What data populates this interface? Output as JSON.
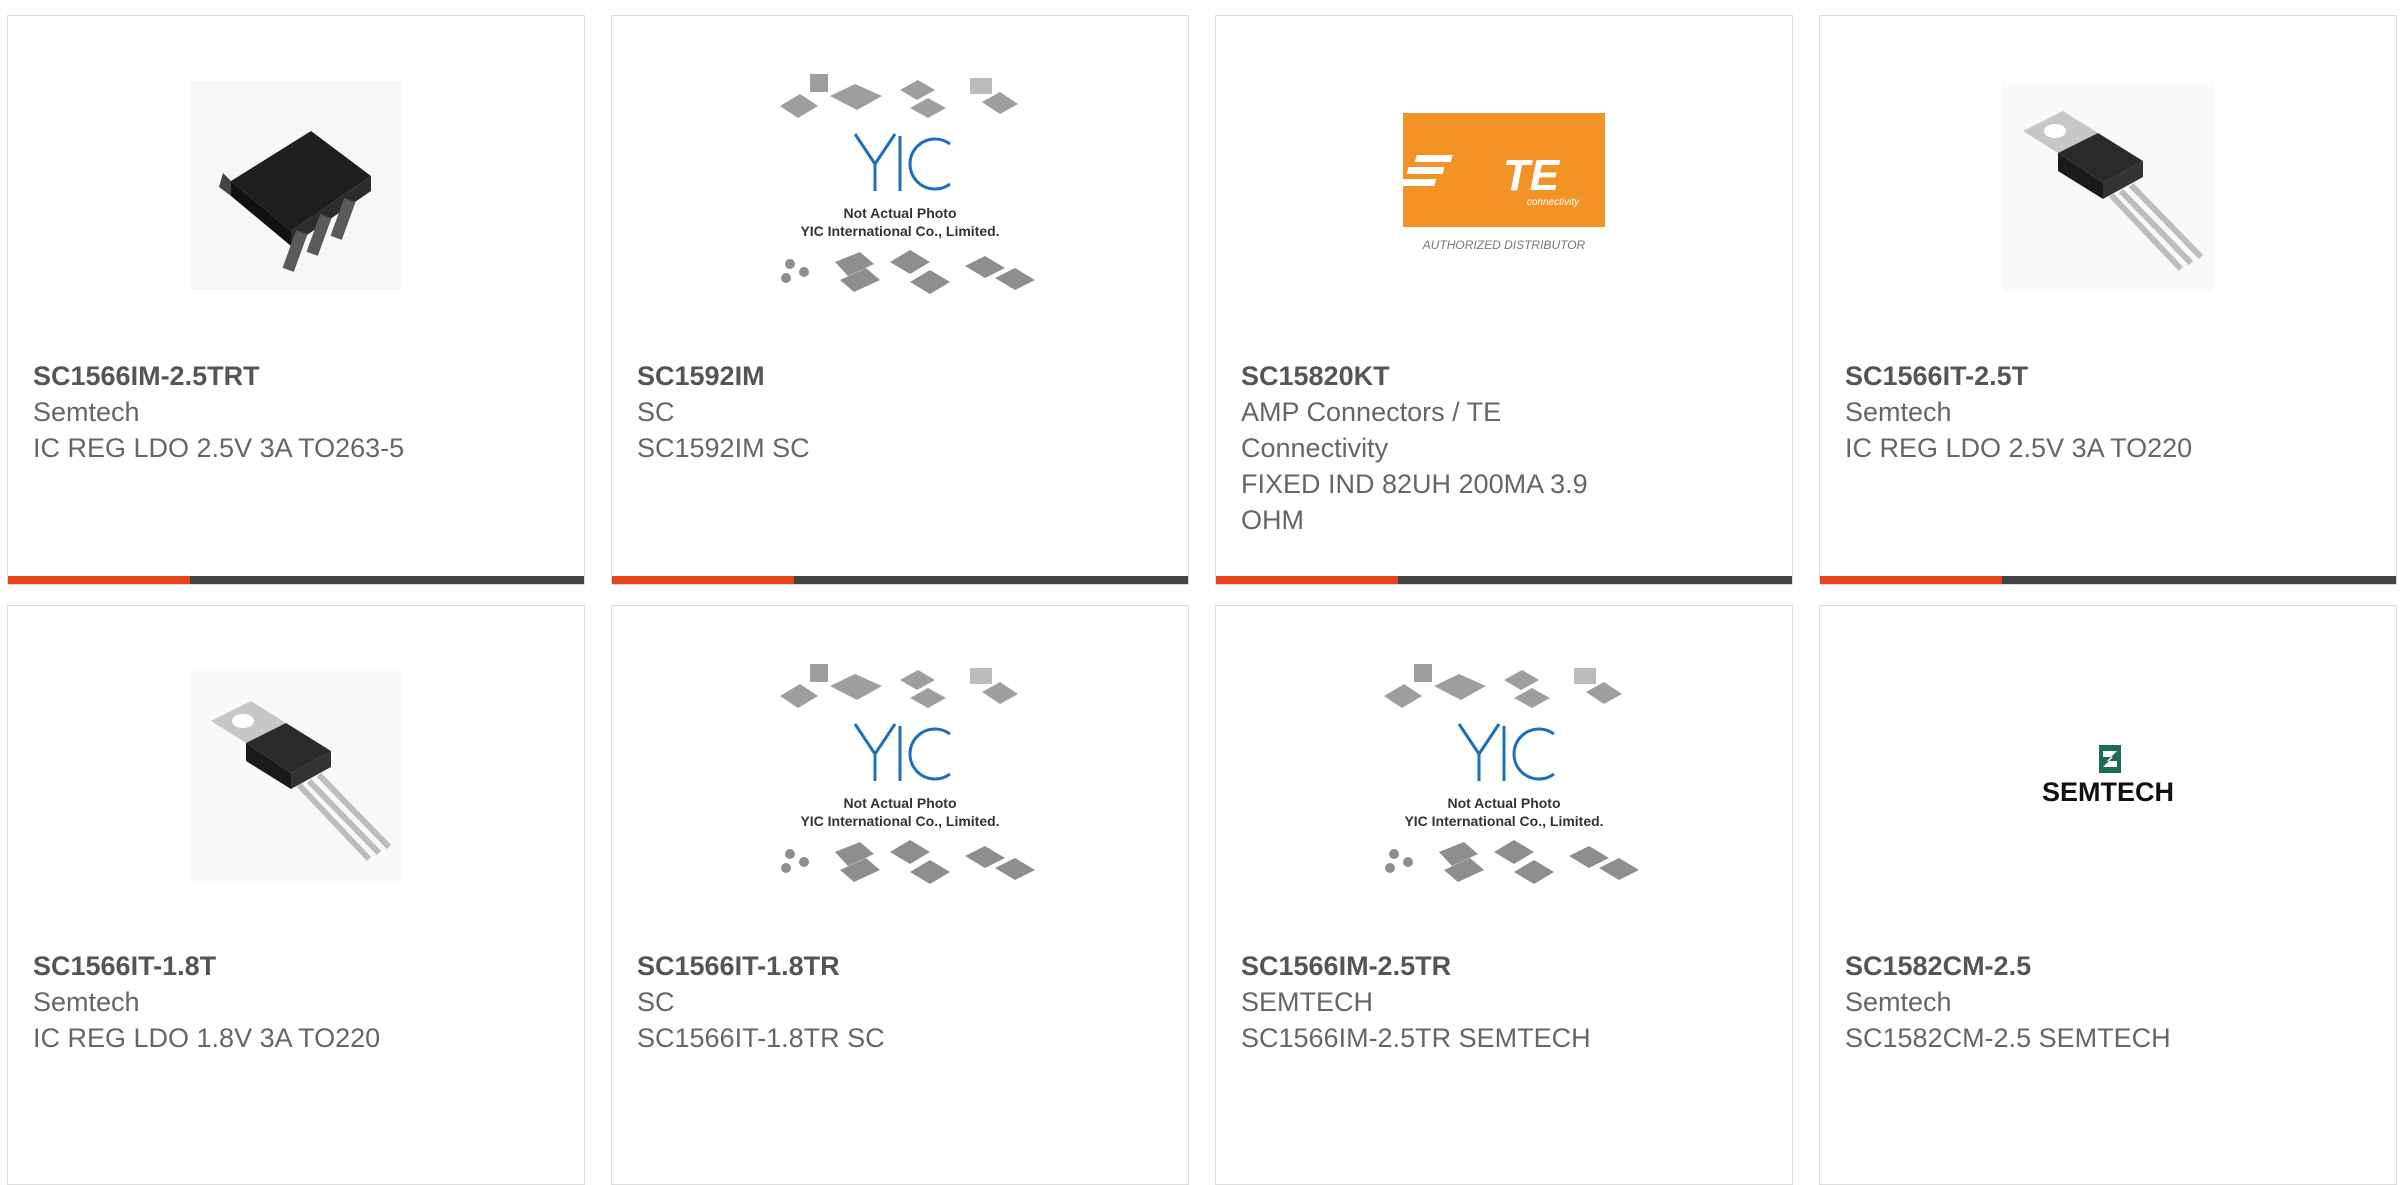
{
  "products": [
    {
      "part": "SC1566IM-2.5TRT",
      "maker": "Semtech",
      "desc": "IC REG LDO 2.5V 3A TO263-5",
      "image": "to263-icon"
    },
    {
      "part": "SC1592IM",
      "maker": "SC",
      "desc": "SC1592IM SC",
      "image": "yic-placeholder-icon",
      "image_text": [
        "Not Actual Photo",
        "YIC International Co., Limited."
      ]
    },
    {
      "part": "SC15820KT",
      "maker": "AMP Connectors / TE Connectivity",
      "desc": "FIXED IND 82UH 200MA 3.9 OHM",
      "image": "te-logo-icon",
      "image_text": [
        "TE",
        "connectivity",
        "AUTHORIZED DISTRIBUTOR"
      ]
    },
    {
      "part": "SC1566IT-2.5T",
      "maker": "Semtech",
      "desc": "IC REG LDO 2.5V 3A TO220",
      "image": "to220-icon"
    },
    {
      "part": "SC1566IT-1.8T",
      "maker": "Semtech",
      "desc": "IC REG LDO 1.8V 3A TO220",
      "image": "to220-icon"
    },
    {
      "part": "SC1566IT-1.8TR",
      "maker": "SC",
      "desc": "SC1566IT-1.8TR SC",
      "image": "yic-placeholder-icon",
      "image_text": [
        "Not Actual Photo",
        "YIC International Co., Limited."
      ]
    },
    {
      "part": "SC1566IM-2.5TR",
      "maker": "SEMTECH",
      "desc": "SC1566IM-2.5TR SEMTECH",
      "image": "yic-placeholder-icon",
      "image_text": [
        "Not Actual Photo",
        "YIC International Co., Limited."
      ]
    },
    {
      "part": "SC1582CM-2.5",
      "maker": "Semtech",
      "desc": "SC1582CM-2.5 SEMTECH",
      "image": "semtech-logo-icon",
      "image_text": [
        "SEMTECH"
      ]
    }
  ],
  "colors": {
    "accent": "#e8431a",
    "bar": "#444444",
    "te_orange": "#f39325",
    "yic_blue": "#1e6fb8"
  }
}
